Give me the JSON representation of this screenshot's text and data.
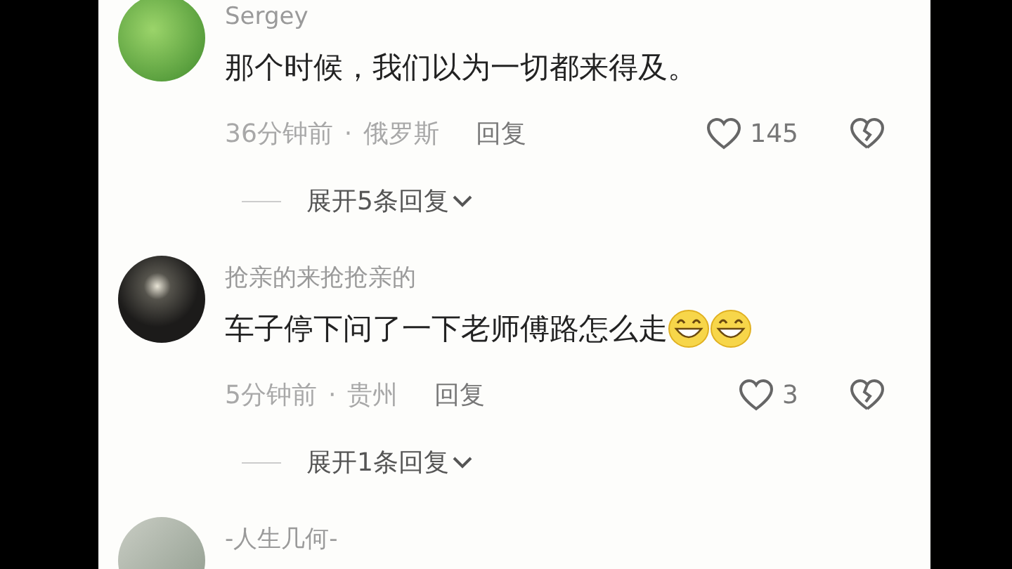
{
  "comments": [
    {
      "username": "Sergey",
      "text": "那个时候，我们以为一切都来得及。",
      "time": "36分钟前",
      "separator": "·",
      "location": "俄罗斯",
      "reply": "回复",
      "likes": "145",
      "expand": "展开5条回复"
    },
    {
      "username": "抢亲的来抢抢亲的",
      "text": "车子停下问了一下老师傅路怎么走",
      "emojis": [
        {
          "kind": "grin"
        },
        {
          "kind": "grin"
        }
      ],
      "time": "5分钟前",
      "separator": "·",
      "location": "贵州",
      "reply": "回复",
      "likes": "3",
      "expand": "展开1条回复"
    },
    {
      "username": "-人生几何-"
    }
  ]
}
